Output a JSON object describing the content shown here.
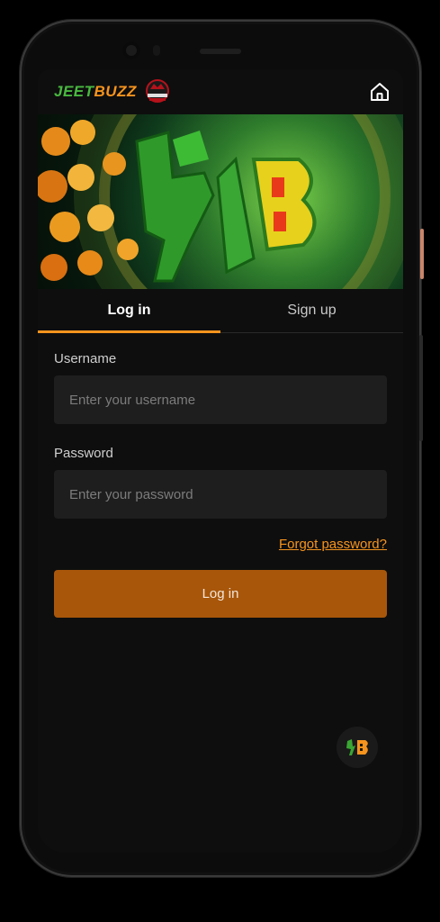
{
  "app": {
    "brand_main": "JEET",
    "brand_accent": "BUZZ",
    "partner_logo": "montreal-tigers-logo"
  },
  "header": {
    "home_icon": "home-icon"
  },
  "tabs": [
    {
      "label": "Log in",
      "active": true
    },
    {
      "label": "Sign up",
      "active": false
    }
  ],
  "form": {
    "username_label": "Username",
    "username_placeholder": "Enter your username",
    "username_value": "",
    "password_label": "Password",
    "password_placeholder": "Enter your password",
    "password_value": "",
    "forgot_label": "Forgot password?",
    "submit_label": "Log in"
  },
  "fab": {
    "icon": "jb-logo-icon"
  },
  "colors": {
    "accent": "#f7941d",
    "button": "#a8560a",
    "brand_green": "#49b840",
    "input_bg": "#1e1e1e",
    "screen_bg": "#0e0e0e"
  }
}
